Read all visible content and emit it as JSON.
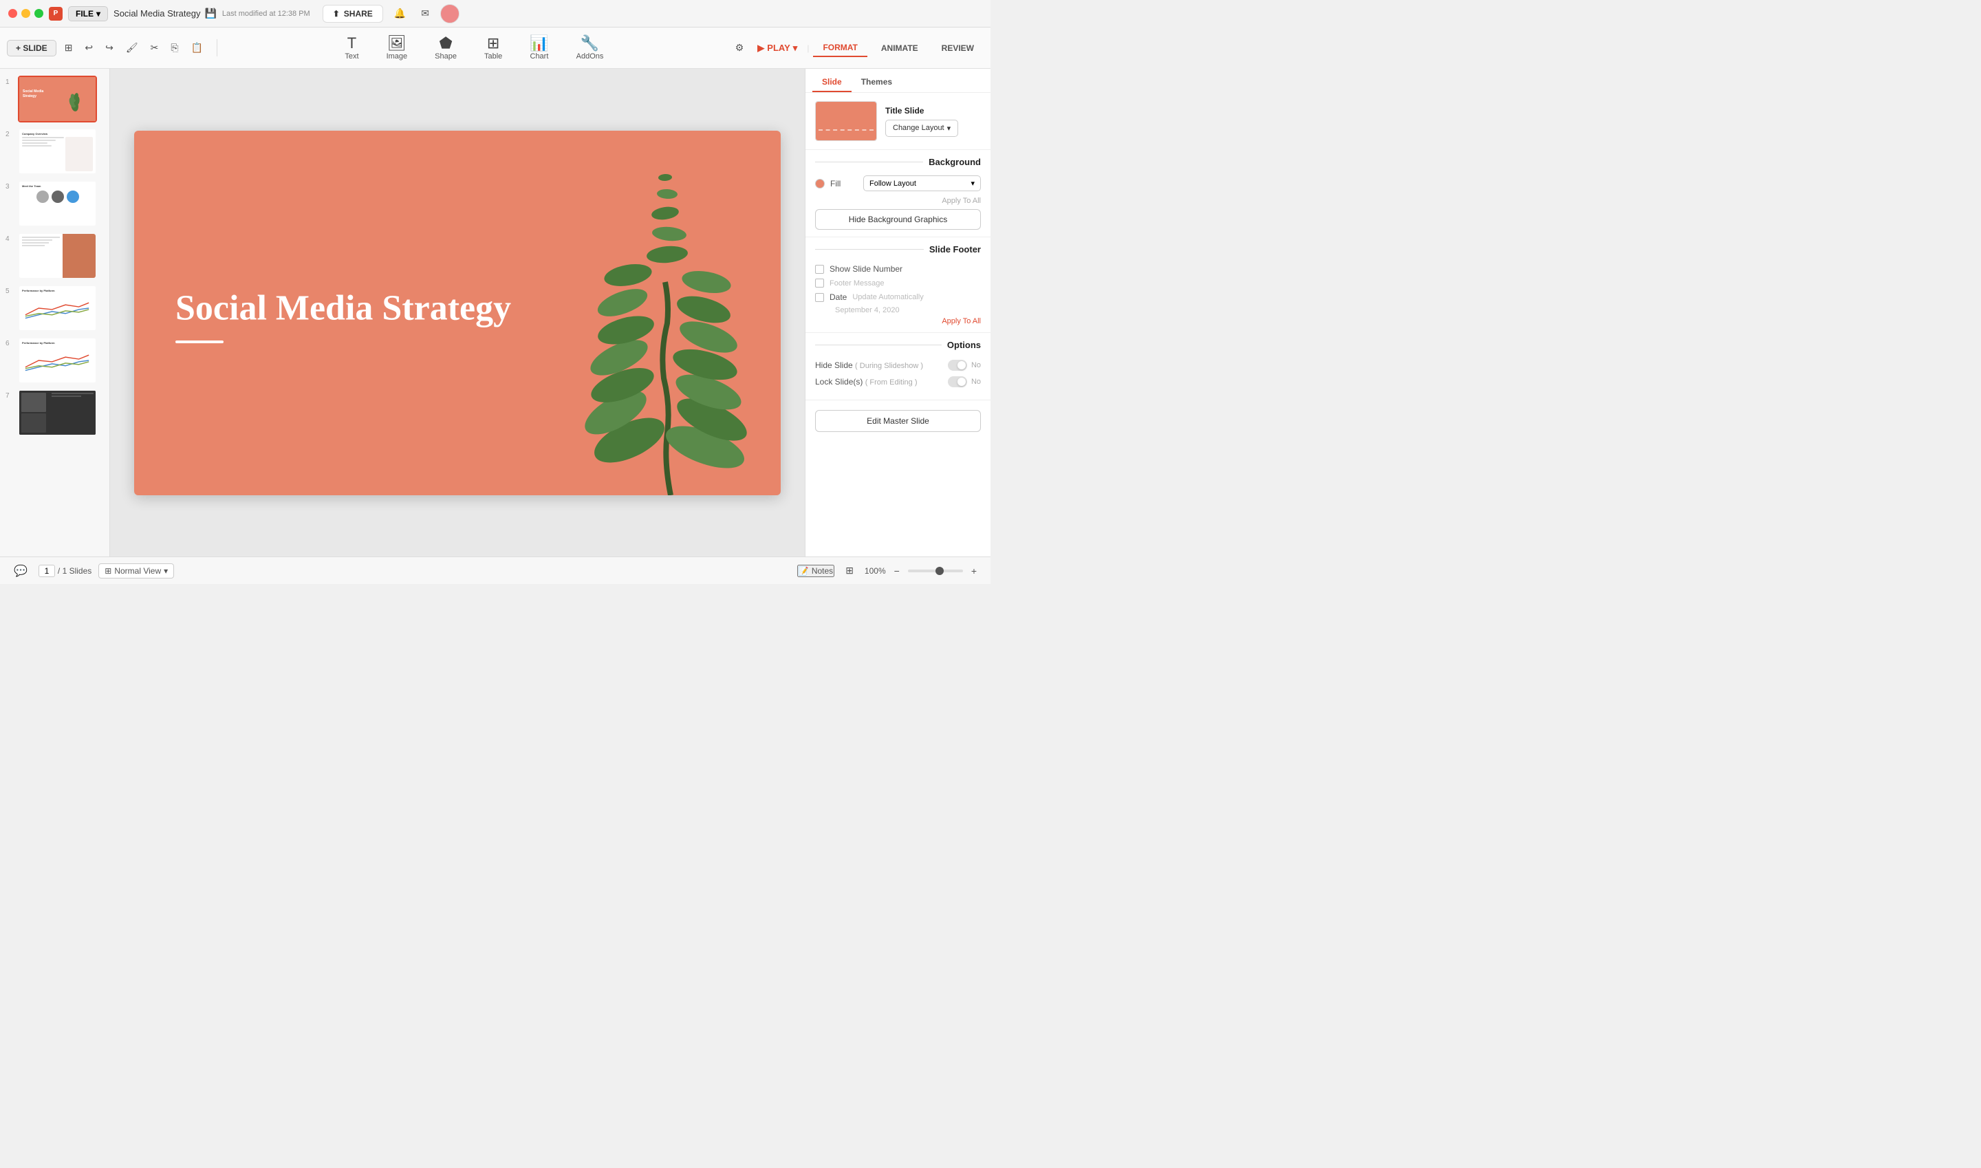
{
  "titleBar": {
    "docTitle": "Social Media Strategy",
    "fileLabel": "FILE",
    "shareLabel": "SHARE",
    "lastModified": "Last modified at 12:38 PM"
  },
  "toolbar": {
    "slideLabel": "+ SLIDE",
    "playLabel": "PLAY",
    "formatLabel": "FORMAT",
    "animateLabel": "ANIMATE",
    "reviewLabel": "REVIEW",
    "tools": [
      {
        "icon": "T",
        "label": "Text"
      },
      {
        "icon": "🖼",
        "label": "Image"
      },
      {
        "icon": "⬟",
        "label": "Shape"
      },
      {
        "icon": "⊞",
        "label": "Table"
      },
      {
        "icon": "📊",
        "label": "Chart"
      },
      {
        "icon": "🔧",
        "label": "AddOns"
      }
    ]
  },
  "slidePanel": {
    "slides": [
      {
        "num": "1",
        "active": true
      },
      {
        "num": "2",
        "active": false
      },
      {
        "num": "3",
        "active": false
      },
      {
        "num": "4",
        "active": false
      },
      {
        "num": "5",
        "active": false
      },
      {
        "num": "6",
        "active": false
      },
      {
        "num": "7",
        "active": false
      }
    ]
  },
  "mainSlide": {
    "title": "Social Media Strategy"
  },
  "rightPanel": {
    "tabs": [
      {
        "label": "Slide",
        "active": true
      },
      {
        "label": "Themes",
        "active": false
      }
    ],
    "layout": {
      "title": "Title Slide",
      "changeLabel": "Change Layout"
    },
    "background": {
      "sectionTitle": "Background",
      "fillLabel": "Fill",
      "fillOption": "Follow Layout",
      "applyAllLabel": "Apply To All",
      "hideBgLabel": "Hide Background Graphics"
    },
    "footer": {
      "sectionTitle": "Slide Footer",
      "showSlideNumber": "Show Slide Number",
      "footerMessage": "Footer Message",
      "date": "Date",
      "updateAuto": "Update Automatically",
      "dateValue": "September 4, 2020",
      "applyAll": "Apply To All"
    },
    "options": {
      "sectionTitle": "Options",
      "hideSlide": "Hide Slide",
      "hideSlideParens": "( During Slideshow )",
      "lockSlide": "Lock Slide(s)",
      "lockSlideParens": "( From Editing )",
      "noLabel": "No"
    },
    "editMaster": "Edit Master Slide"
  },
  "bottomBar": {
    "pageNum": "1",
    "totalSlides": "/ 1 Slides",
    "viewLabel": "Normal View",
    "notesLabel": "Notes",
    "zoomLevel": "100%"
  }
}
